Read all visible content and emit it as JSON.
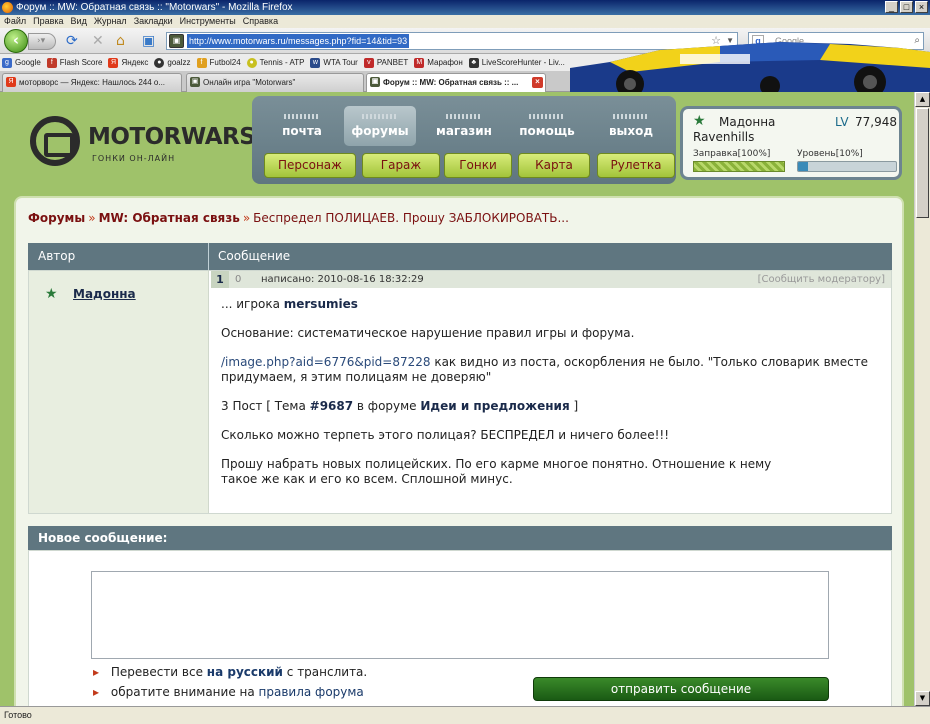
{
  "browser": {
    "title": "Форум :: MW: Обратная связь :: \"Motorwars\" - Mozilla Firefox",
    "menu": [
      "Файл",
      "Правка",
      "Вид",
      "Журнал",
      "Закладки",
      "Инструменты",
      "Справка"
    ],
    "url": "http://www.motorwars.ru/messages.php?fid=14&tid=93",
    "search_placeholder": "Google",
    "bookmarks": [
      "Google",
      "Flash Score",
      "Яндекс",
      "goalzz",
      "Futbol24",
      "Tennis - ATP",
      "WTA Tour",
      "PANBET",
      "Марафон",
      "LiveScoreHunter - Liv..."
    ],
    "tabs": [
      "моторворс — Яндекс: Нашлось 244 о...",
      "Онлайн игра \"Motorwars\"",
      "Форум :: MW: Обратная связь :: ..."
    ],
    "status": "Готово"
  },
  "site": {
    "logo": "MOTORWARS.RU",
    "logo_sub": "ГОНКИ ОН-ЛАЙН",
    "top_nav": [
      "почта",
      "форумы",
      "магазин",
      "помощь",
      "выход"
    ],
    "sub_nav": [
      "Персонаж",
      "Гараж",
      "Гонки",
      "Карта",
      "Рулетка"
    ],
    "user": {
      "name": "Мадонна Ravenhills",
      "lv_label": "LV",
      "lv_value": "77,948",
      "fuel_label": "Заправка[100%]",
      "fuel_level": 100,
      "level_label": "Уровень[10%]",
      "level_progress": 10
    }
  },
  "forum": {
    "breadcrumb": {
      "root": "Форумы",
      "section": "MW: Обратная связь",
      "topic": "Беспредел ПОЛИЦАЕВ. Прошу ЗАБЛОКИРОВАТЬ..."
    },
    "columns": {
      "author": "Автор",
      "message": "Сообщение"
    },
    "post": {
      "author": "Мадонна",
      "number": "1",
      "rating": "0",
      "posted": "написано: 2010-08-16 18:32:29",
      "report": "[Сообщить модератору]",
      "p1_prefix": "... игрока ",
      "p1_name": "mersumies",
      "p2": "Основание: систематическое нарушение правил игры и форума.",
      "p3_link": "/image.php?aid=6776&pid=87228",
      "p3_text": " как видно из поста, оскорбления не было. \"Только словарик вместе придумаем, я этим полицаям не доверяю\"",
      "p4_a": "3 Пост [ Тема ",
      "p4_topic": "#9687",
      "p4_b": " в форуме ",
      "p4_forum": "Идеи и предложения",
      "p4_c": " ]",
      "p5": "Сколько можно терпеть этого полицая? БЕСПРЕДЕЛ и ничего более!!!",
      "p6_line1": "Прошу набрать новых полицейских. По его карме многое понятно. Отношение к нему",
      "p6_line2": "такое же как и его ко всем. Сплошной минус."
    },
    "reply": {
      "title": "Новое сообщение:",
      "hint1_a": "Перевести все ",
      "hint1_b": "на русский",
      "hint1_c": " с транслита.",
      "hint2_a": "обратите внимание на ",
      "hint2_b": "правила форума",
      "send": "отправить сообщение"
    }
  }
}
